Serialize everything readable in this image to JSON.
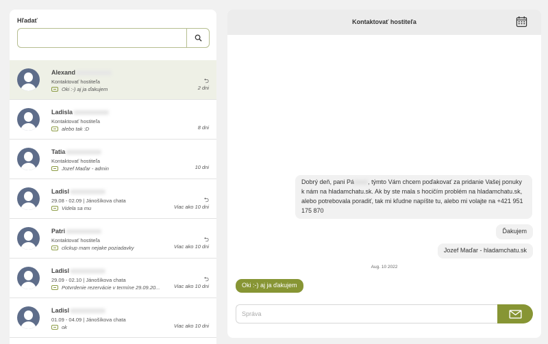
{
  "search": {
    "label": "Hľadať",
    "value": "",
    "placeholder": ""
  },
  "conversations": [
    {
      "name": "Alexand",
      "subject": "Kontaktovať hostiteľa",
      "preview": "Oki :-) aj ja ďakujem",
      "time": "2 dni",
      "replied": true,
      "active": true
    },
    {
      "name": "Ladisla",
      "subject": "Kontaktovať hostiteľa",
      "preview": "alebo tak :D",
      "time": "8 dni",
      "replied": false,
      "active": false
    },
    {
      "name": "Tatia",
      "subject": "Kontaktovať hostiteľa",
      "preview": "Jozef Maďar - admin",
      "time": "10 dni",
      "replied": false,
      "active": false
    },
    {
      "name": "Ladisl",
      "subject": "29.08 - 02.09 | Jánošíkova chata",
      "preview": "Videla sa mu",
      "time": "Viac ako 10 dni",
      "replied": true,
      "active": false
    },
    {
      "name": "Patri",
      "subject": "Kontaktovať hostiteľa",
      "preview": "clickup mam nejake poziadavky",
      "time": "Viac ako 10 dni",
      "replied": true,
      "active": false
    },
    {
      "name": "Ladisl",
      "subject": "29.09 - 02.10 | Jánošíkova chata",
      "preview": "Potvrdenie rezervácie v termíne 29.09.20...",
      "time": "Viac ako 10 dni",
      "replied": true,
      "active": false
    },
    {
      "name": "Ladisl",
      "subject": "01.09 - 04.09 | Jánošíkova chata",
      "preview": "ok",
      "time": "Viac ako 10 dni",
      "replied": false,
      "active": false
    }
  ],
  "chat": {
    "title": "Kontaktovať hostiteľa",
    "messages": {
      "m1_part1": "Dobrý deň, pani Pá",
      "m1_part2": ", týmto Vám chcem poďakovať za pridanie Vašej ponuky k nám na hladamchatu.sk. Ak by ste mala s hocičím problém na hladamchatu.sk, alebo potrebovala poradiť, tak mi kľudne napíšte tu, alebo mi volajte na +421 951 175 870",
      "m2": "Ďakujem",
      "m3": "Jozef Maďar - hladamchatu.sk",
      "date": "Aug. 10 2022",
      "m4": "Oki :-) aj ja ďakujem"
    },
    "compose_placeholder": "Správa",
    "compose_value": ""
  },
  "icons": {
    "search": "search-icon",
    "calendar": "calendar-icon",
    "send": "envelope-icon",
    "reply": "reply-arrow-icon",
    "message": "message-icon"
  },
  "colors": {
    "accent": "#879534",
    "avatar": "#5e6d8a",
    "active_row": "#eef0e6"
  }
}
